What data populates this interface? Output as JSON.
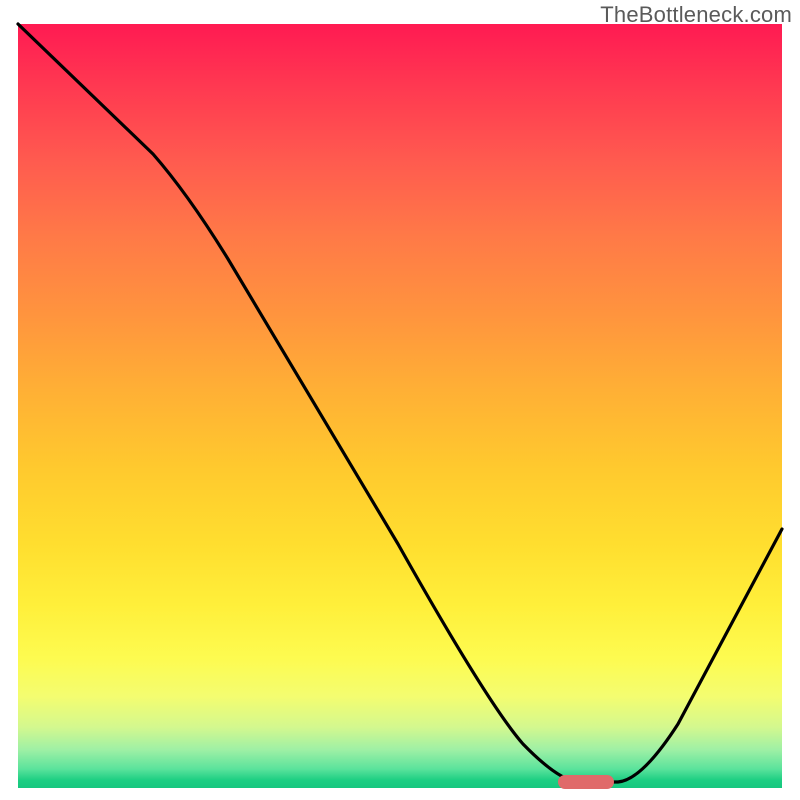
{
  "watermark": "TheBottleneck.com",
  "chart_data": {
    "type": "line",
    "title": "",
    "xlabel": "",
    "ylabel": "",
    "xlim": [
      0,
      100
    ],
    "ylim": [
      0,
      100
    ],
    "grid": false,
    "legend": false,
    "background_gradient": {
      "top_color": "#ff1a52",
      "mid_color": "#ffde2f",
      "bottom_color": "#16c77f"
    },
    "series": [
      {
        "name": "bottleneck-curve",
        "color": "#000000",
        "x": [
          0,
          12,
          25,
          40,
          55,
          63,
          70,
          76,
          80,
          100
        ],
        "values": [
          100,
          88,
          75,
          50,
          25,
          8,
          1,
          0,
          1,
          35
        ]
      }
    ],
    "annotations": [
      {
        "name": "optimal-range-marker",
        "type": "hspan",
        "x_start": 70,
        "x_end": 77,
        "y": 0,
        "color": "#e06a6a"
      }
    ]
  }
}
